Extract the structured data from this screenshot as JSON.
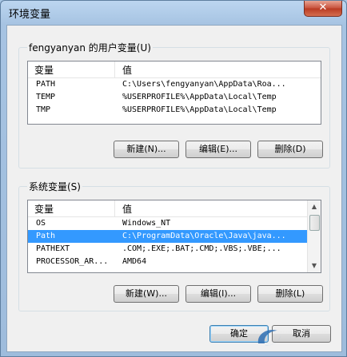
{
  "window": {
    "title": "环境变量",
    "close_glyph": "✕"
  },
  "user_vars": {
    "group_label": "fengyanyan 的用户变量(U)",
    "col_variable": "变量",
    "col_value": "值",
    "rows": [
      {
        "name": "PATH",
        "value": "C:\\Users\\fengyanyan\\AppData\\Roa..."
      },
      {
        "name": "TEMP",
        "value": "%USERPROFILE%\\AppData\\Local\\Temp"
      },
      {
        "name": "TMP",
        "value": "%USERPROFILE%\\AppData\\Local\\Temp"
      }
    ],
    "new_label": "新建(N)...",
    "edit_label": "编辑(E)...",
    "delete_label": "删除(D)"
  },
  "system_vars": {
    "group_label": "系统变量(S)",
    "col_variable": "变量",
    "col_value": "值",
    "rows": [
      {
        "name": "OS",
        "value": "Windows_NT",
        "selected": false
      },
      {
        "name": "Path",
        "value": "C:\\ProgramData\\Oracle\\Java\\java...",
        "selected": true
      },
      {
        "name": "PATHEXT",
        "value": ".COM;.EXE;.BAT;.CMD;.VBS;.VBE;...",
        "selected": false
      },
      {
        "name": "PROCESSOR_AR...",
        "value": "AMD64",
        "selected": false
      }
    ],
    "new_label": "新建(W)...",
    "edit_label": "编辑(I)...",
    "delete_label": "删除(L)"
  },
  "footer": {
    "ok_label": "确定",
    "cancel_label": "取消"
  },
  "colors": {
    "selection": "#3399ff",
    "title_bg": "#bcd6f0",
    "close": "#c7503a"
  }
}
